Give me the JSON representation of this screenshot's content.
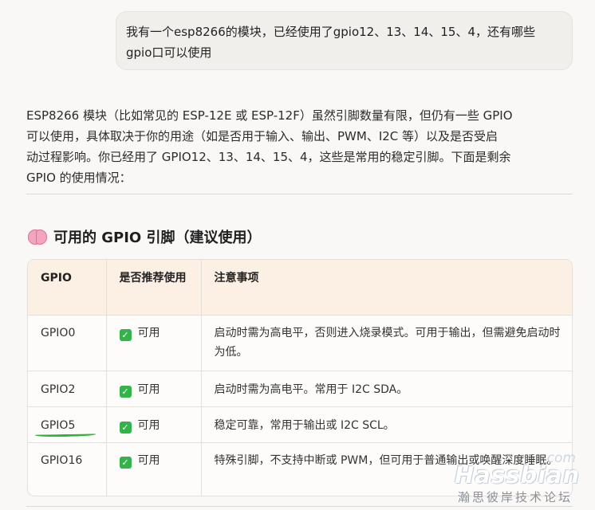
{
  "user_message": {
    "line1": "我有一个esp8266的模块，已经使用了gpio12、13、14、15、4，还有哪些",
    "line2": "gpio口可以使用"
  },
  "reply": {
    "intro_lines": [
      "ESP8266 模块（比如常见的 ESP-12E 或 ESP-12F）虽然引脚数量有限，但仍有一些 GPIO",
      "可以使用，具体取决于你的用途（如是否用于输入、输出、PWM、I2C 等）以及是否受启",
      "动过程影响。你已经用了 GPIO12、13、14、15、4，这些是常用的稳定引脚。下面是剩余",
      "GPIO 的使用情况："
    ],
    "section_icon": "brain-icon",
    "section_title": "可用的 GPIO 引脚（建议使用）"
  },
  "table": {
    "headers": [
      "GPIO",
      "是否推荐使用",
      "注意事项"
    ],
    "rows": [
      {
        "gpio": "GPIO0",
        "status_icon": "check-icon",
        "status": "可用",
        "note": "启动时需为高电平，否则进入烧录模式。可用于输出，但需避免启动时为低。"
      },
      {
        "gpio": "GPIO2",
        "status_icon": "check-icon",
        "status": "可用",
        "note": "启动时需为高电平。常用于 I2C SDA。"
      },
      {
        "gpio": "GPIO5",
        "status_icon": "check-icon",
        "status": "可用",
        "note": "稳定可靠，常用于输出或 I2C SCL。"
      },
      {
        "gpio": "GPIO16",
        "status_icon": "check-icon",
        "status": "可用",
        "note": "特殊引脚，不支持中断或 PWM，但可用于普通输出或唤醒深度睡眠。"
      }
    ]
  },
  "watermark": {
    "suffix": "com",
    "brand": "Hassbian",
    "chinese": "瀚思彼岸技术论坛"
  },
  "colors": {
    "page_bg": "#faf8f6",
    "bubble_bg": "#f1efec",
    "table_header_bg": "#fcefe3",
    "check_green": "#33b34a",
    "annotation_green": "#2fb33a"
  }
}
